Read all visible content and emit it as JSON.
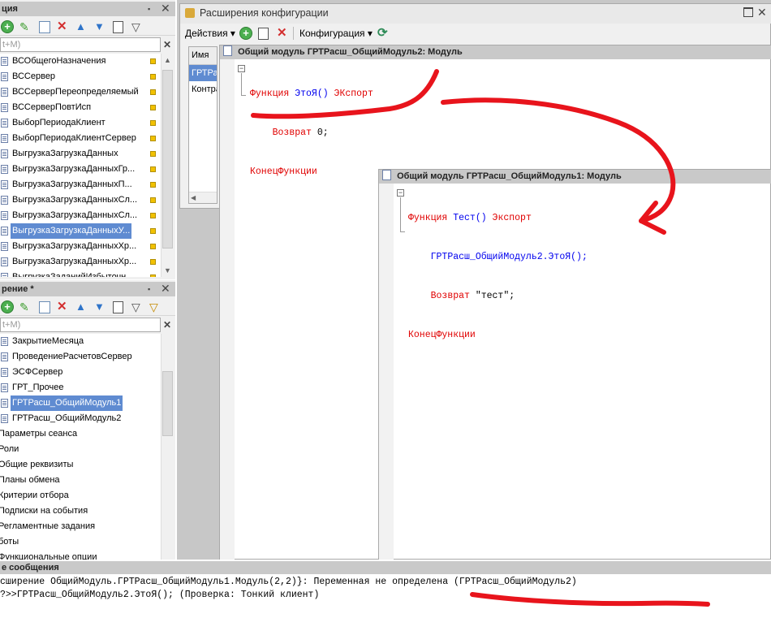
{
  "top_panel": {
    "title": "ция",
    "search_placeholder": "t+M)",
    "items": [
      {
        "label": "ВСОбщегоНазначения",
        "selected": false
      },
      {
        "label": "ВССервер",
        "selected": false
      },
      {
        "label": "ВССерверПереопределяемый",
        "selected": false
      },
      {
        "label": "ВССерверПовтИсп",
        "selected": false
      },
      {
        "label": "ВыборПериодаКлиент",
        "selected": false
      },
      {
        "label": "ВыборПериодаКлиентСервер",
        "selected": false
      },
      {
        "label": "ВыгрузкаЗагрузкаДанных",
        "selected": false
      },
      {
        "label": "ВыгрузкаЗагрузкаДанныхГр...",
        "selected": false
      },
      {
        "label": "ВыгрузкаЗагрузкаДанныхП...",
        "selected": false
      },
      {
        "label": "ВыгрузкаЗагрузкаДанныхСл...",
        "selected": false
      },
      {
        "label": "ВыгрузкаЗагрузкаДанныхСл...",
        "selected": false
      },
      {
        "label": "ВыгрузкаЗагрузкаДанныхУ...",
        "selected": true
      },
      {
        "label": "ВыгрузкаЗагрузкаДанныхХр...",
        "selected": false
      },
      {
        "label": "ВыгрузкаЗагрузкаДанныхХр...",
        "selected": false
      },
      {
        "label": "ВыгрузкаЗаданийИзбыточн",
        "selected": false
      }
    ]
  },
  "bottom_panel": {
    "title": "рение *",
    "search_placeholder": "t+M)",
    "modules": [
      {
        "label": "ЗакрытиеМесяца",
        "selected": false
      },
      {
        "label": "ПроведениеРасчетовСервер",
        "selected": false
      },
      {
        "label": "ЭСФСервер",
        "selected": false
      },
      {
        "label": "ГРТ_Прочее",
        "selected": false
      },
      {
        "label": "ГРТРасш_ОбщийМодуль1",
        "selected": true
      },
      {
        "label": "ГРТРасш_ОбщийМодуль2",
        "selected": false
      }
    ],
    "groups": [
      "Параметры сеанса",
      "Роли",
      "Общие реквизиты",
      "Планы обмена",
      "Критерии отбора",
      "Подписки на события",
      "Регламентные задания",
      "боты",
      "Функциональные опции"
    ]
  },
  "extensions_window": {
    "title": "Расширения конфигурации",
    "actions_label": "Действия",
    "config_label": "Конфигурация",
    "col_name": "Имя",
    "rows": [
      "ГРТРа",
      "Контра"
    ]
  },
  "module2": {
    "title": "Общий модуль ГРТРасш_ОбщийМодуль2: Модуль",
    "line1_kw": "Функция",
    "line1_name": "ЭтоЯ()",
    "line1_export": "ЭКспорт",
    "line2_kw": "Возврат",
    "line2_val": "0;",
    "line3_kw": "КонецФункции"
  },
  "module1": {
    "title": "Общий модуль ГРТРасш_ОбщийМодуль1: Модуль",
    "line1_kw": "Функция",
    "line1_name": "Тест()",
    "line1_export": "Экспорт",
    "line2_call": "ГРТРасш_ОбщийМодуль2.ЭтоЯ();",
    "line3_kw": "Возврат",
    "line3_val": "\"тест\";",
    "line4_kw": "КонецФункции"
  },
  "messages": {
    "title": "е сообщения",
    "line1": "сширение ОбщийМодуль.ГРТРасш_ОбщийМодуль1.Модуль(2,2)}: Переменная не определена (ГРТРасш_ОбщийМодуль2)",
    "line2": "?>>ГРТРасш_ОбщийМодуль2.ЭтоЯ(); (Проверка: Тонкий клиент)"
  },
  "colors": {
    "annotation": "#e8141c",
    "selection": "#5f8bd1",
    "keyword": "#e00000",
    "identifier": "#0000ee"
  }
}
